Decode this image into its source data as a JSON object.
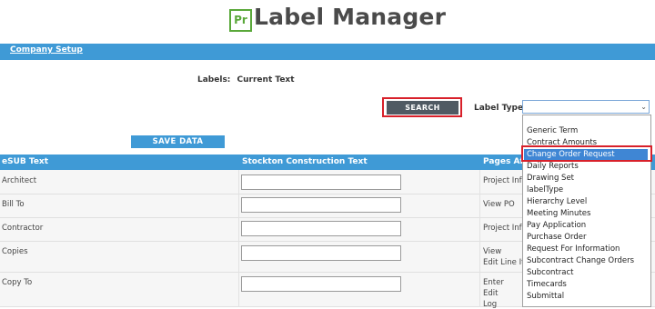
{
  "header": {
    "logo_text": "Pr",
    "title": "Label Manager"
  },
  "nav": {
    "company_setup": "Company Setup"
  },
  "labels_line": {
    "label": "Labels:",
    "value": "Current Text"
  },
  "search": {
    "label": "SEARCH"
  },
  "label_type": {
    "label": "Label Type:",
    "selected": ""
  },
  "save": {
    "label": "SAVE DATA"
  },
  "table": {
    "headers": [
      "eSUB Text",
      "Stockton Construction Text",
      "Pages Aff"
    ],
    "rows": [
      {
        "esub": "Architect",
        "pages": [
          "Project Inf"
        ]
      },
      {
        "esub": "Bill To",
        "pages": [
          "View PO"
        ]
      },
      {
        "esub": "Contractor",
        "pages": [
          "Project Inf"
        ]
      },
      {
        "esub": "Copies",
        "pages": [
          "View",
          "Edit Line It"
        ]
      },
      {
        "esub": "Copy To",
        "pages": [
          "Enter",
          "Edit",
          "Log"
        ]
      }
    ]
  },
  "dropdown": {
    "options": [
      "Generic Term",
      "Contract Amounts",
      "Change Order Request",
      "Daily Reports",
      "Drawing Set",
      "labelType",
      "Hierarchy Level",
      "Meeting Minutes",
      "Pay Application",
      "Purchase Order",
      "Request For Information",
      "Subcontract Change Orders",
      "Subcontract",
      "Timecards",
      "Submittal"
    ],
    "selected": "Change Order Request"
  },
  "colors": {
    "accent": "#3f9ad6",
    "highlight": "#d8202a",
    "logo": "#5aa83a",
    "button_dark": "#505a63"
  }
}
